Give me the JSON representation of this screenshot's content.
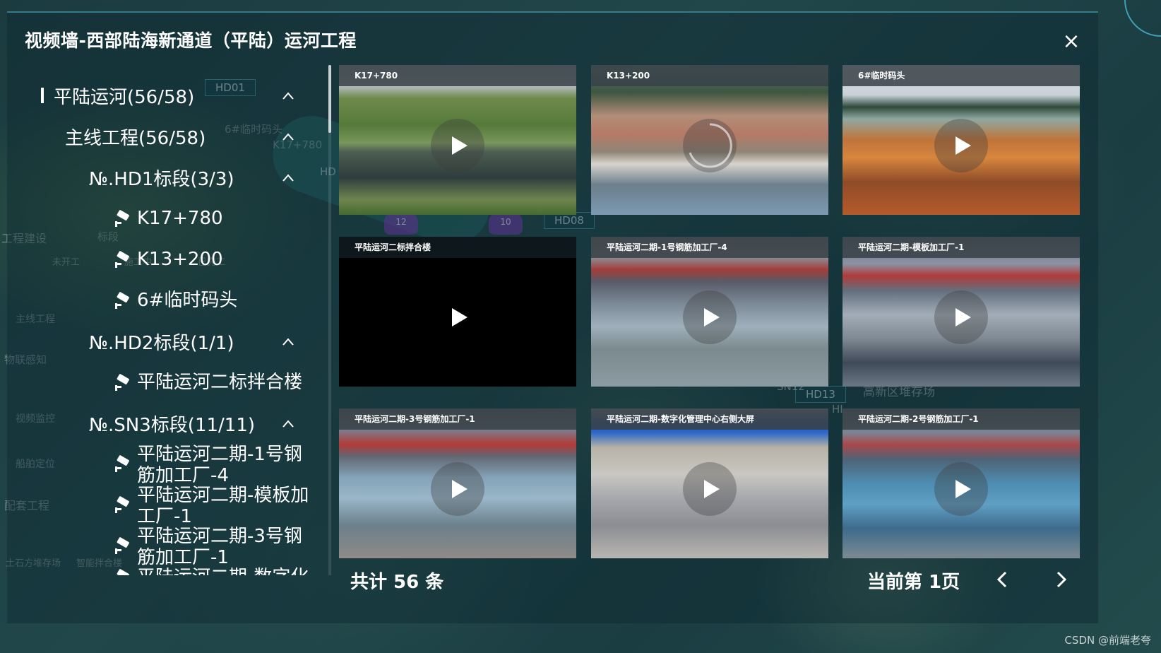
{
  "title": "视频墙-西部陆海新通道（平陆）运河工程",
  "close_icon": "×",
  "tree": {
    "root": "平陆运河(56/58)",
    "main_line": "主线工程(56/58)",
    "sections": [
      {
        "label": "№.HD1标段(3/3)",
        "cameras": [
          "K17+780",
          "K13+200",
          "6#临时码头"
        ]
      },
      {
        "label": "№.HD2标段(1/1)",
        "cameras": [
          "平陆运河二标拌合楼"
        ]
      },
      {
        "label": "№.SN3标段(11/11)",
        "cameras": [
          "平陆运河二期-1号钢筋加工厂-4",
          "平陆运河二期-模板加工厂-1",
          "平陆运河二期-3号钢筋加工厂-1",
          "平陆运河二期-数字化"
        ]
      }
    ]
  },
  "videos": [
    {
      "caption": "K17+780",
      "scene": "lake"
    },
    {
      "caption": "K13+200",
      "scene": "site"
    },
    {
      "caption": "6#临时码头",
      "scene": "dock"
    },
    {
      "caption": "平陆运河二标拌合楼",
      "scene": "black"
    },
    {
      "caption": "平陆运河二期-1号钢筋加工厂-4",
      "scene": "hall"
    },
    {
      "caption": "平陆运河二期-模板加工厂-1",
      "scene": "hall2"
    },
    {
      "caption": "平陆运河二期-3号钢筋加工厂-1",
      "scene": "hall3"
    },
    {
      "caption": "平陆运河二期-数字化管理中心右侧大屏",
      "scene": "control"
    },
    {
      "caption": "平陆运河二期-2号钢筋加工厂-1",
      "scene": "hall4"
    }
  ],
  "footer": {
    "total": "共计 56 条",
    "current_page": "当前第 1页"
  },
  "map_labels": {
    "hd01": "HD01",
    "hd08": "HD08",
    "hd13": "HD13",
    "sn12": "SN12",
    "hd_partial": "HD",
    "h_partial": "HI",
    "k17": "K17+780",
    "temp_dock": "6#临时码头",
    "engineering": "工程建设",
    "bid": "标段",
    "not_started": "未开工",
    "in_progress": "施工中",
    "completed": "已完工",
    "main_eng": "主线工程",
    "iot": "物联感知",
    "video_mon": "视频监控",
    "ship_pos": "船舶定位",
    "support_eng": "配套工程",
    "storage": "土石方堆存场",
    "mixing": "智能拌合楼",
    "hightech": "高新区堆存场",
    "dot1": "12",
    "dot2": "10"
  },
  "watermark": "CSDN @前端老夸",
  "colors": {
    "accent": "#4fc3d8",
    "panel": "#0e2830"
  }
}
